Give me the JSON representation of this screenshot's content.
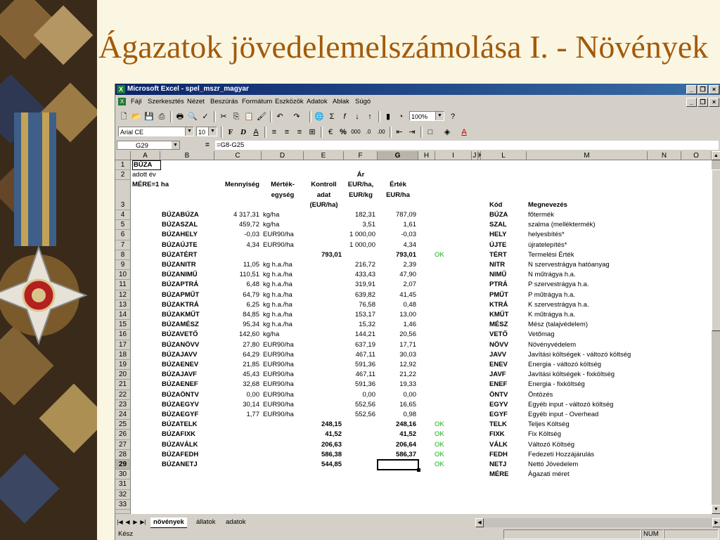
{
  "slide": {
    "title": "Ágazatok jövedelemelszámolása I. - Növények"
  },
  "window": {
    "title": "Microsoft Excel - spel_mszr_magyar"
  },
  "menu": [
    "Fájl",
    "Szerkesztés",
    "Nézet",
    "Beszúrás",
    "Formátum",
    "Eszközök",
    "Adatok",
    "Ablak",
    "Súgó"
  ],
  "toolbar": {
    "zoom": "100%",
    "font": "Arial CE",
    "size": "10"
  },
  "formula": {
    "cell": "G29",
    "content": "=G8-G25"
  },
  "columns": [
    "A",
    "B",
    "C",
    "D",
    "E",
    "F",
    "G",
    "H",
    "I",
    "J",
    "K",
    "L",
    "M",
    "N",
    "O"
  ],
  "header": {
    "A1": "BÚZA",
    "A2": "adott év",
    "A3": "MÉRE=1 ha",
    "C3": "Mennyiség",
    "D3a": "Mérték-",
    "D3b": "egység",
    "E3a": "Kontroll",
    "E3b": "adat",
    "E3c": "(EUR/ha)",
    "F2": "Ár",
    "F3a": "EUR/ha,",
    "F3b": "EUR/kg",
    "G3a": "Érték",
    "G3b": "EUR/ha",
    "L3": "Kód",
    "M3": "Megnevezés"
  },
  "rows": [
    {
      "n": "4",
      "b": "BÚZABÚZA",
      "c": "4 317,31",
      "d": "kg/ha",
      "e": "",
      "f": "182,31",
      "g": "787,09",
      "i": "",
      "l": "BÚZA",
      "m": "főtermék",
      "eb": false,
      "gb": false
    },
    {
      "n": "5",
      "b": "BÚZASZAL",
      "c": "459,72",
      "d": "kg/ha",
      "e": "",
      "f": "3,51",
      "g": "1,61",
      "i": "",
      "l": "SZAL",
      "m": "szalma (melléktermék)",
      "eb": false,
      "gb": false
    },
    {
      "n": "6",
      "b": "BÚZAHELY",
      "c": "-0,03",
      "d": "EUR90/ha",
      "e": "",
      "f": "1 000,00",
      "g": "-0,03",
      "i": "",
      "l": "HELY",
      "m": "helyesbítés*",
      "eb": false,
      "gb": false
    },
    {
      "n": "7",
      "b": "BÚZAÚJTE",
      "c": "4,34",
      "d": "EUR90/ha",
      "e": "",
      "f": "1 000,00",
      "g": "4,34",
      "i": "",
      "l": "ÚJTE",
      "m": "újratelepítés*",
      "eb": false,
      "gb": false
    },
    {
      "n": "8",
      "b": "BÚZATÉRT",
      "c": "",
      "d": "",
      "e": "793,01",
      "f": "",
      "g": "793,01",
      "i": "OK",
      "l": "TÉRT",
      "m": "Termelési Érték",
      "eb": true,
      "gb": true
    },
    {
      "n": "9",
      "b": "BÚZANITR",
      "c": "11,05",
      "d": "kg h.a./ha",
      "e": "",
      "f": "216,72",
      "g": "2,39",
      "i": "",
      "l": "NITR",
      "m": "N szervestrágya hatóanyag",
      "eb": false,
      "gb": false
    },
    {
      "n": "10",
      "b": "BÚZANIMŰ",
      "c": "110,51",
      "d": "kg h.a./ha",
      "e": "",
      "f": "433,43",
      "g": "47,90",
      "i": "",
      "l": "NIMŰ",
      "m": "N műtrágya h.a.",
      "eb": false,
      "gb": false
    },
    {
      "n": "11",
      "b": "BÚZAPTRÁ",
      "c": "6,48",
      "d": "kg h.a./ha",
      "e": "",
      "f": "319,91",
      "g": "2,07",
      "i": "",
      "l": "PTRÁ",
      "m": "P szervestrágya h.a.",
      "eb": false,
      "gb": false
    },
    {
      "n": "12",
      "b": "BÚZAPMŰT",
      "c": "64,79",
      "d": "kg h.a./ha",
      "e": "",
      "f": "639,82",
      "g": "41,45",
      "i": "",
      "l": "PMŰT",
      "m": "P műtrágya h.a.",
      "eb": false,
      "gb": false
    },
    {
      "n": "13",
      "b": "BÚZAKTRÁ",
      "c": "6,25",
      "d": "kg h.a./ha",
      "e": "",
      "f": "76,58",
      "g": "0,48",
      "i": "",
      "l": "KTRÁ",
      "m": "K szervestrágya h.a.",
      "eb": false,
      "gb": false
    },
    {
      "n": "14",
      "b": "BÚZAKMŰT",
      "c": "84,85",
      "d": "kg h.a./ha",
      "e": "",
      "f": "153,17",
      "g": "13,00",
      "i": "",
      "l": "KMŰT",
      "m": "K műtrágya h.a.",
      "eb": false,
      "gb": false
    },
    {
      "n": "15",
      "b": "BÚZAMÉSZ",
      "c": "95,34",
      "d": "kg h.a./ha",
      "e": "",
      "f": "15,32",
      "g": "1,46",
      "i": "",
      "l": "MÉSZ",
      "m": "Mész (talajvédelem)",
      "eb": false,
      "gb": false
    },
    {
      "n": "16",
      "b": "BÚZAVETŐ",
      "c": "142,60",
      "d": "kg/ha",
      "e": "",
      "f": "144,21",
      "g": "20,56",
      "i": "",
      "l": "VETŐ",
      "m": "Vetőmag",
      "eb": false,
      "gb": false
    },
    {
      "n": "17",
      "b": "BÚZANÖVV",
      "c": "27,80",
      "d": "EUR90/ha",
      "e": "",
      "f": "637,19",
      "g": "17,71",
      "i": "",
      "l": "NÖVV",
      "m": "Növényvédelem",
      "eb": false,
      "gb": false
    },
    {
      "n": "18",
      "b": "BÚZAJAVV",
      "c": "64,29",
      "d": "EUR90/ha",
      "e": "",
      "f": "467,11",
      "g": "30,03",
      "i": "",
      "l": "JAVV",
      "m": "Javítási költségek - változó költség",
      "eb": false,
      "gb": false
    },
    {
      "n": "19",
      "b": "BÚZAENEV",
      "c": "21,85",
      "d": "EUR90/ha",
      "e": "",
      "f": "591,36",
      "g": "12,92",
      "i": "",
      "l": "ENEV",
      "m": "Energia - változó költség",
      "eb": false,
      "gb": false
    },
    {
      "n": "20",
      "b": "BÚZAJAVF",
      "c": "45,43",
      "d": "EUR90/ha",
      "e": "",
      "f": "467,11",
      "g": "21,22",
      "i": "",
      "l": "JAVF",
      "m": "Javítási költségek - fixköltség",
      "eb": false,
      "gb": false
    },
    {
      "n": "21",
      "b": "BÚZAENEF",
      "c": "32,68",
      "d": "EUR90/ha",
      "e": "",
      "f": "591,36",
      "g": "19,33",
      "i": "",
      "l": "ENEF",
      "m": "Energia - fixköltség",
      "eb": false,
      "gb": false
    },
    {
      "n": "22",
      "b": "BÚZAÖNTV",
      "c": "0,00",
      "d": "EUR90/ha",
      "e": "",
      "f": "0,00",
      "g": "0,00",
      "i": "",
      "l": "ÖNTV",
      "m": "Öntözés",
      "eb": false,
      "gb": false
    },
    {
      "n": "23",
      "b": "BÚZAEGYV",
      "c": "30,14",
      "d": "EUR90/ha",
      "e": "",
      "f": "552,56",
      "g": "16,65",
      "i": "",
      "l": "EGYV",
      "m": "Egyéb input - változó költség",
      "eb": false,
      "gb": false
    },
    {
      "n": "24",
      "b": "BÚZAEGYF",
      "c": "1,77",
      "d": "EUR90/ha",
      "e": "",
      "f": "552,56",
      "g": "0,98",
      "i": "",
      "l": "EGYF",
      "m": "Egyéb input - Overhead",
      "eb": false,
      "gb": false
    },
    {
      "n": "25",
      "b": "BÚZATELK",
      "c": "",
      "d": "",
      "e": "248,15",
      "f": "",
      "g": "248,16",
      "i": "OK",
      "l": "TELK",
      "m": "Teljes Költség",
      "eb": true,
      "gb": true
    },
    {
      "n": "26",
      "b": "BÚZAFIXK",
      "c": "",
      "d": "",
      "e": "41,52",
      "f": "",
      "g": "41,52",
      "i": "OK",
      "l": "FIXK",
      "m": "Fix Költség",
      "eb": true,
      "gb": true
    },
    {
      "n": "27",
      "b": "BÚZAVÁLK",
      "c": "",
      "d": "",
      "e": "206,63",
      "f": "",
      "g": "206,64",
      "i": "OK",
      "l": "VÁLK",
      "m": "Változó Költség",
      "eb": true,
      "gb": true
    },
    {
      "n": "28",
      "b": "BÚZAFEDH",
      "c": "",
      "d": "",
      "e": "586,38",
      "f": "",
      "g": "586,37",
      "i": "OK",
      "l": "FEDH",
      "m": "Fedezeti Hozzájárulás",
      "eb": true,
      "gb": true
    },
    {
      "n": "29",
      "b": "BÚZANETJ",
      "c": "",
      "d": "",
      "e": "544,85",
      "f": "",
      "g": "",
      "i": "OK",
      "l": "NETJ",
      "m": "Nettó Jövedelem",
      "eb": true,
      "gb": true
    },
    {
      "n": "30",
      "b": "",
      "c": "",
      "d": "",
      "e": "",
      "f": "",
      "g": "",
      "i": "",
      "l": "MÉRE",
      "m": "Ágazati méret",
      "eb": false,
      "gb": false
    },
    {
      "n": "31",
      "b": "",
      "c": "",
      "d": "",
      "e": "",
      "f": "",
      "g": "",
      "i": "",
      "l": "",
      "m": "",
      "eb": false,
      "gb": false
    },
    {
      "n": "32",
      "b": "",
      "c": "",
      "d": "",
      "e": "",
      "f": "",
      "g": "",
      "i": "",
      "l": "",
      "m": "",
      "eb": false,
      "gb": false
    },
    {
      "n": "33",
      "b": "",
      "c": "",
      "d": "",
      "e": "",
      "f": "",
      "g": "",
      "i": "",
      "l": "",
      "m": "",
      "eb": false,
      "gb": false
    }
  ],
  "sheets": [
    "növények",
    "állatok",
    "adatok"
  ],
  "status": {
    "left": "Kész",
    "num": "NUM"
  },
  "colors": {
    "ok": "#18b018",
    "title": "#a35a0a",
    "titlebar": "#0a246a"
  }
}
